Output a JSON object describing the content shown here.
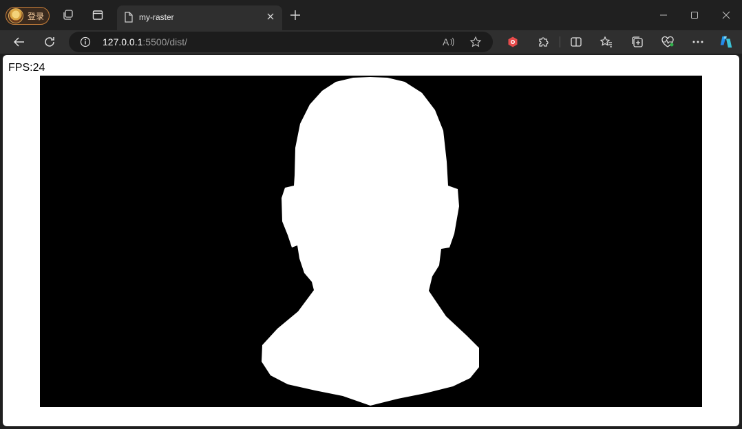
{
  "profile": {
    "label": "登录"
  },
  "tab": {
    "title": "my-raster"
  },
  "address": {
    "host": "127.0.0.1",
    "path": ":5500/dist/"
  },
  "page": {
    "fps_label": "FPS:24"
  },
  "colors": {
    "tabstrip_bg": "#202020",
    "toolbar_bg": "#2f2f2f",
    "profile_border": "#c67e3a",
    "canvas_bg": "#000000",
    "render_fill": "#ffffff"
  },
  "icons": {
    "profile": "avatar",
    "workspaces": "workspaces-icon",
    "tab_actions": "tab-actions-icon",
    "favicon": "page-icon",
    "close": "close-icon",
    "new_tab": "plus-icon",
    "back": "arrow-left-icon",
    "refresh": "refresh-icon",
    "info": "info-icon",
    "read_aloud": "read-aloud-icon",
    "favorite": "star-icon",
    "extension_1": "hexagon-icon",
    "extensions": "puzzle-icon",
    "split_screen": "split-screen-icon",
    "favorites": "favorites-icon",
    "collections": "collections-icon",
    "browser_essentials": "heart-pulse-icon",
    "more": "more-icon",
    "copilot": "copilot-icon"
  }
}
